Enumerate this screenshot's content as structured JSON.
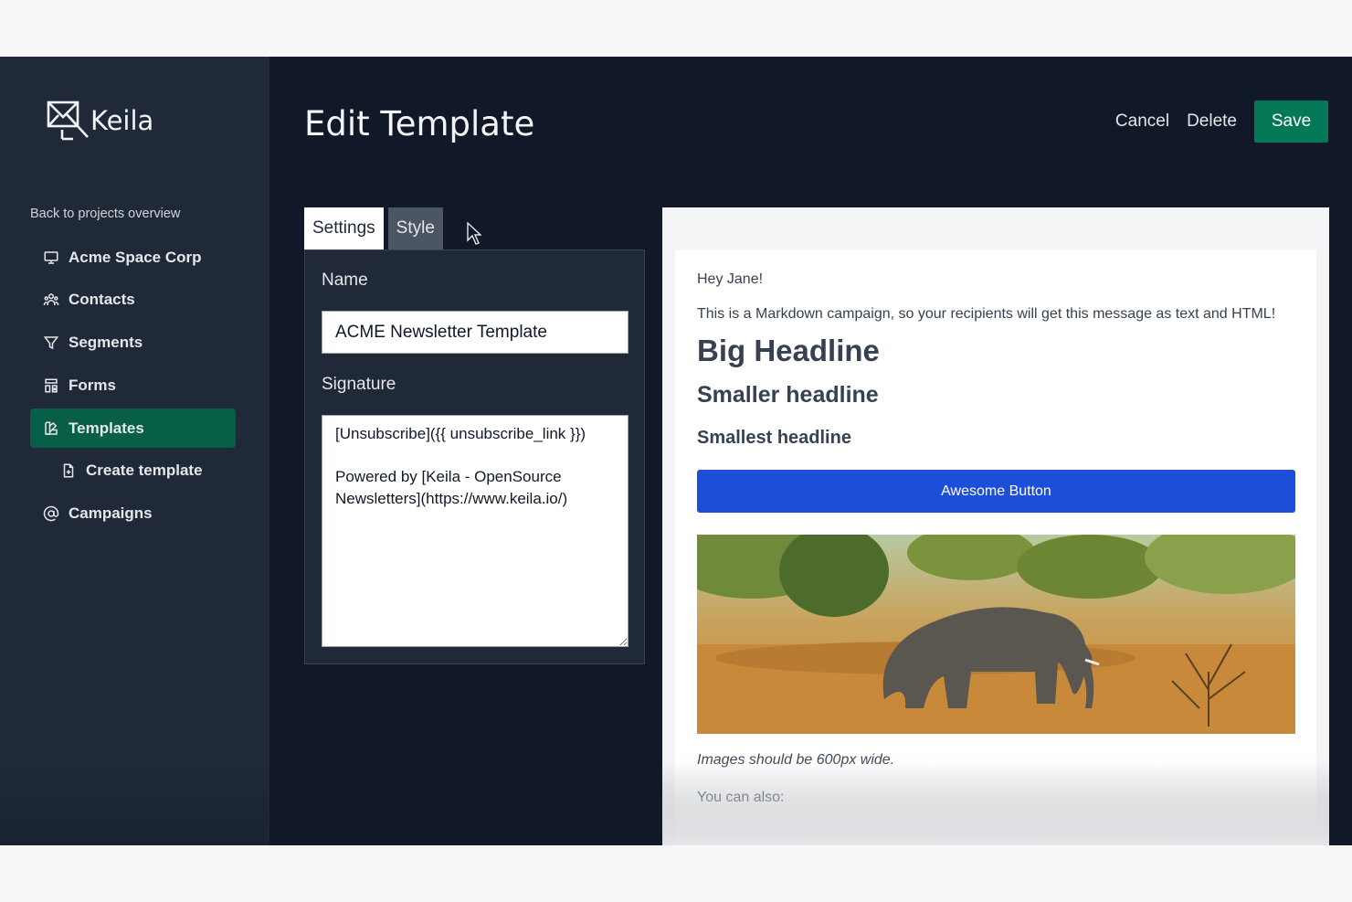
{
  "app": {
    "name": "Keila"
  },
  "sidebar": {
    "back_link": "Back to projects overview",
    "items": [
      {
        "label": "Acme Space Corp",
        "icon": "monitor-icon"
      },
      {
        "label": "Contacts",
        "icon": "users-icon"
      },
      {
        "label": "Segments",
        "icon": "filter-icon"
      },
      {
        "label": "Forms",
        "icon": "forms-icon"
      },
      {
        "label": "Templates",
        "icon": "templates-icon",
        "active": true
      },
      {
        "label": "Create template",
        "icon": "file-plus-icon",
        "sub": true
      },
      {
        "label": "Campaigns",
        "icon": "at-sign-icon"
      }
    ]
  },
  "header": {
    "title": "Edit Template",
    "cancel_label": "Cancel",
    "delete_label": "Delete",
    "save_label": "Save"
  },
  "tabs": [
    {
      "label": "Settings",
      "active": true
    },
    {
      "label": "Style",
      "active": false
    }
  ],
  "settings": {
    "name_label": "Name",
    "name_value": "ACME Newsletter Template",
    "signature_label": "Signature",
    "signature_value": "[Unsubscribe]({{ unsubscribe_link }})\n\nPowered by [Keila - OpenSource Newsletters](https://www.keila.io/)"
  },
  "preview": {
    "greeting": "Hey Jane!",
    "intro": "This is a Markdown campaign, so your recipients will get this message as text and HTML!",
    "h1": "Big Headline",
    "h2": "Smaller headline",
    "h3": "Smallest headline",
    "button_label": "Awesome Button",
    "image_subject": "elephant-photo",
    "caption": "Images should be 600px wide.",
    "also": "You can also:"
  },
  "colors": {
    "background": "#111827",
    "sidebar": "#1f2937",
    "accent_green": "#047857",
    "active_nav": "#065f46",
    "preview_button": "#1d4ed8"
  }
}
